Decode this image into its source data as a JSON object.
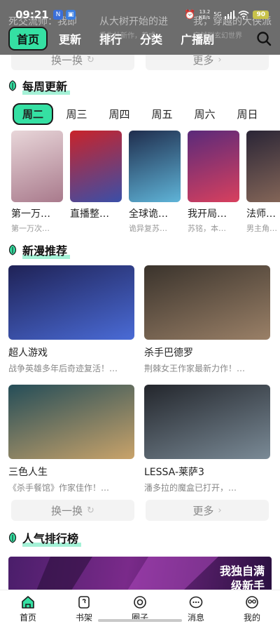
{
  "status_bar": {
    "time": "09:21",
    "net_speed": "13.2\nKB/s",
    "signal": "5G",
    "battery": "90"
  },
  "background_titles": [
    {
      "title": "死交流师：我即",
      "sub": ""
    },
    {
      "title": "从大树开始的进",
      "sub": "重生社新作，养成"
    },
    {
      "title": "我，穿越的大侠派",
      "sub": "穿越到玄幻世界"
    }
  ],
  "top_nav": {
    "tabs": [
      {
        "label": "首页",
        "active": true
      },
      {
        "label": "更新"
      },
      {
        "label": "排行"
      },
      {
        "label": "分类"
      },
      {
        "label": "广播剧"
      }
    ]
  },
  "top_buttons": {
    "refresh": "换一换",
    "more": "更多"
  },
  "weekly": {
    "title": "每周更新",
    "days": [
      "周二",
      "周三",
      "周四",
      "周五",
      "周六",
      "周日"
    ],
    "active_day": "周二",
    "items": [
      {
        "title": "第一万…",
        "sub": "第一万次…",
        "colors": [
          "#e8d6d9",
          "#a97a8c"
        ]
      },
      {
        "title": "直播整…",
        "sub": "",
        "colors": [
          "#c9232a",
          "#3a4fa8"
        ]
      },
      {
        "title": "全球诡…",
        "sub": "诡异复苏…",
        "colors": [
          "#1f2d4d",
          "#5fb4d8"
        ]
      },
      {
        "title": "我开局…",
        "sub": "苏铭，本…",
        "colors": [
          "#5a2a7a",
          "#d8405e"
        ]
      },
      {
        "title": "法师…",
        "sub": "男主角…",
        "colors": [
          "#2a2536",
          "#8a6a5a"
        ]
      }
    ]
  },
  "new_recs": {
    "title": "新漫推荐",
    "items": [
      {
        "title": "超人游戏",
        "sub": "战争英雄多年后奇迹复活！…",
        "colors": [
          "#1f2256",
          "#4a6bd6"
        ]
      },
      {
        "title": "杀手巴德罗",
        "sub": "荆棘女王作家最新力作！…",
        "colors": [
          "#3a332c",
          "#9a8067"
        ]
      },
      {
        "title": "三色人生",
        "sub": "《杀手餐馆》作家佳作！…",
        "colors": [
          "#244d58",
          "#c9a36a"
        ]
      },
      {
        "title": "LESSA-莱萨3",
        "sub": "潘多拉的魔盒已打开，…",
        "colors": [
          "#23262c",
          "#7a8a96"
        ]
      }
    ],
    "refresh": "换一换",
    "more": "更多"
  },
  "popular": {
    "title": "人气排行榜",
    "banner_text": "我独自满\n级新手"
  },
  "bottom_nav": {
    "items": [
      {
        "label": "首页",
        "icon": "home-icon",
        "active": true
      },
      {
        "label": "书架",
        "icon": "bookshelf-icon"
      },
      {
        "label": "圈子",
        "icon": "circle-icon"
      },
      {
        "label": "消息",
        "icon": "message-icon"
      },
      {
        "label": "我的",
        "icon": "profile-icon"
      }
    ]
  },
  "accent_color": "#35e0a3"
}
